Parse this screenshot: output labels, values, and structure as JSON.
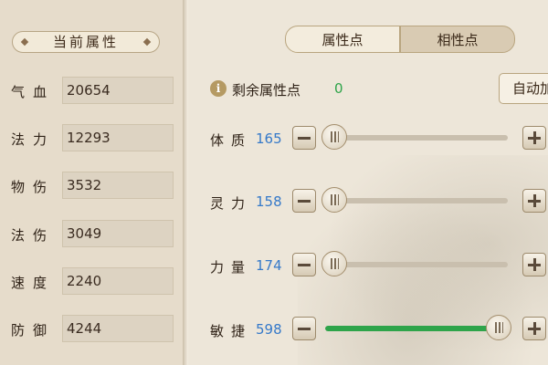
{
  "left": {
    "title": "当前属性",
    "stats": [
      {
        "label": "气血",
        "value": "20654"
      },
      {
        "label": "法力",
        "value": "12293"
      },
      {
        "label": "物伤",
        "value": "3532"
      },
      {
        "label": "法伤",
        "value": "3049"
      },
      {
        "label": "速度",
        "value": "2240"
      },
      {
        "label": "防御",
        "value": "4244"
      }
    ]
  },
  "right": {
    "tabs": [
      {
        "label": "属性点",
        "active": true
      },
      {
        "label": "相性点",
        "active": false
      }
    ],
    "remaining": {
      "label": "剩余属性点",
      "value": "0"
    },
    "auto_button": "自动加点",
    "attributes": [
      {
        "label": "体质",
        "value": "165",
        "level": 0.0
      },
      {
        "label": "灵力",
        "value": "158",
        "level": 0.0
      },
      {
        "label": "力量",
        "value": "174",
        "level": 0.0
      },
      {
        "label": "敏捷",
        "value": "598",
        "level": 1.0
      }
    ]
  },
  "colors": {
    "accent_green": "#2ea44a",
    "value_blue": "#3579c9",
    "frame_brown": "#7b4d2a"
  }
}
